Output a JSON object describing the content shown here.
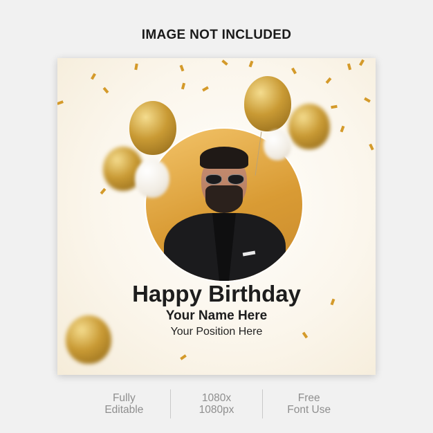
{
  "header": {
    "notice": "IMAGE NOT INCLUDED"
  },
  "card": {
    "title": "Happy Birthday",
    "name": "Your Name Here",
    "position": "Your Position Here",
    "accent_color": "#c99a34"
  },
  "features": [
    {
      "line1": "Fully",
      "line2": "Editable"
    },
    {
      "line1": "1080x",
      "line2": "1080px"
    },
    {
      "line1": "Free",
      "line2": "Font Use"
    }
  ]
}
